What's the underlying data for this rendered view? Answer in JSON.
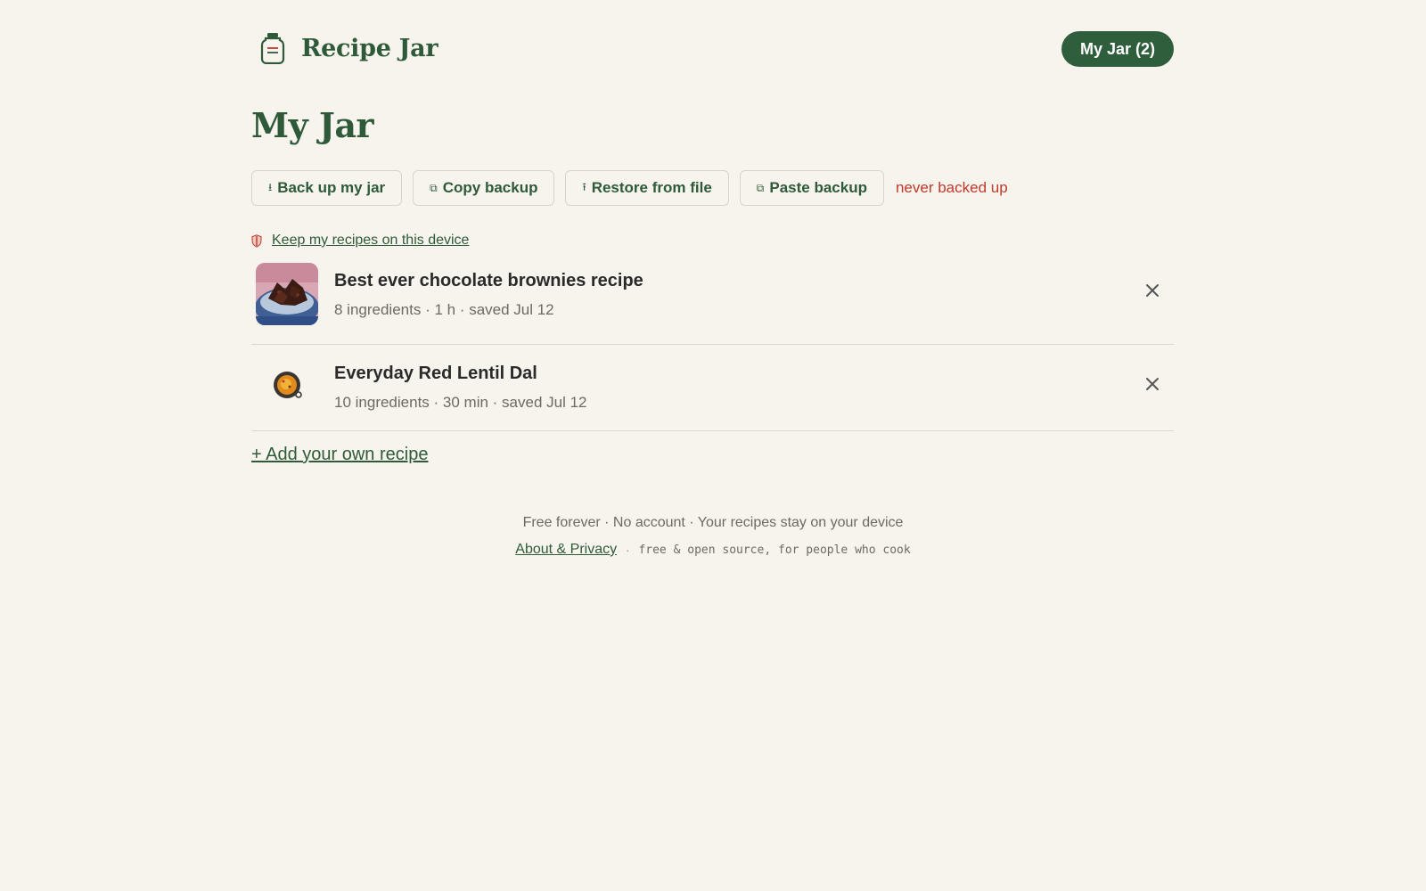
{
  "header": {
    "brand_name": "Recipe Jar",
    "jar_button_label": "My Jar (2)"
  },
  "page_title": "My Jar",
  "toolbar": {
    "backup": {
      "icon": "⭳",
      "label": "Back up my jar"
    },
    "copy": {
      "icon": "⧉",
      "label": "Copy backup"
    },
    "restore": {
      "icon": "⭱",
      "label": "Restore from file"
    },
    "paste": {
      "icon": "⧉",
      "label": "Paste backup"
    },
    "status": "never backed up"
  },
  "keep_link": "Keep my recipes on this device",
  "recipes": [
    {
      "title": "Best ever chocolate brownies recipe",
      "meta": "8 ingredients · 1 h · saved Jul 12",
      "thumb": "brownies-photo"
    },
    {
      "title": "Everyday Red Lentil Dal",
      "meta": "10 ingredients · 30 min · saved Jul 12",
      "thumb": "curry-bowl-icon"
    }
  ],
  "add_link": "+ Add your own recipe",
  "footer": {
    "tagline": "Free forever · No account · Your recipes stay on your device",
    "about_link": "About & Privacy",
    "separator": "·",
    "note": "free & open source, for people who cook"
  },
  "colors": {
    "background": "#f7f4ee",
    "brand_green": "#2e5a3a",
    "pill_green": "#2f5e3c",
    "warning_red": "#c0392b"
  }
}
